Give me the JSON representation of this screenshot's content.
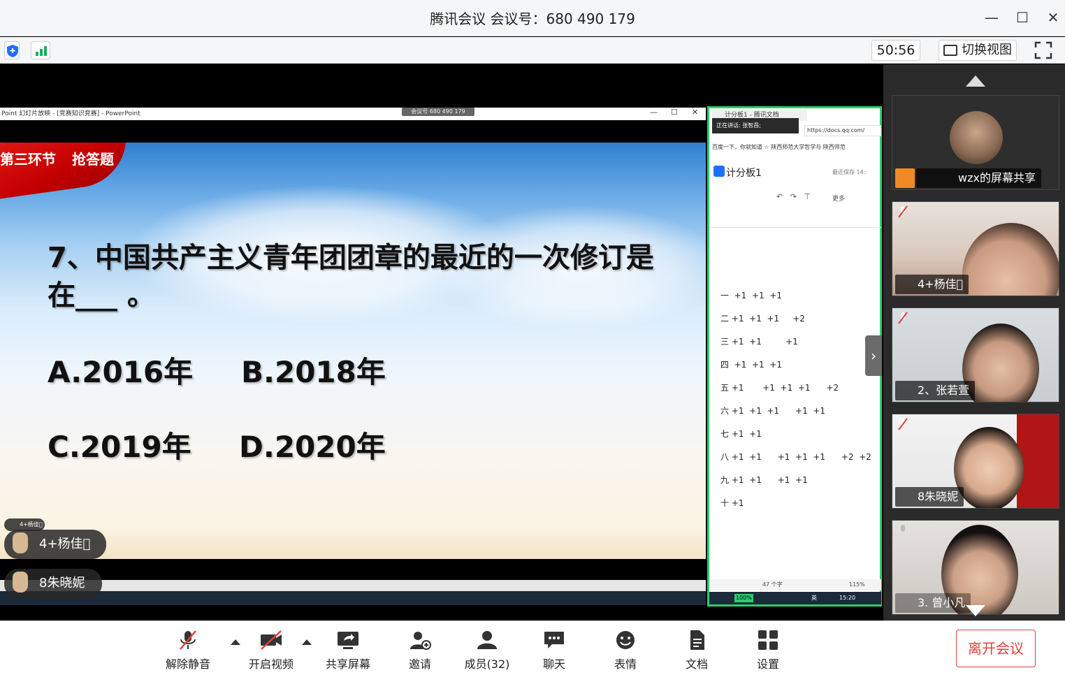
{
  "window": {
    "title": "腾讯会议 会议号：680 490 179",
    "minimize": "—",
    "maximize": "☐",
    "close": "✕"
  },
  "infobar": {
    "timer": "50:56",
    "switch_view": "切换视图"
  },
  "ppt": {
    "window_title": "Point 幻灯片放映 - [竞赛知识竞赛] - PowerPoint",
    "meeting_tag": "会议号 680 490 179",
    "section_label": "第三环节",
    "section_name": "抢答题",
    "question": "7、中国共产主义青年团团章的最近的一次修订是在___ 。",
    "option_a": "A.2016年",
    "option_b": "B.2018年",
    "option_c": "C.2019年",
    "option_d": "D.2020年"
  },
  "raised_hands": [
    {
      "name": "4+杨佳\u0000",
      "mini": "4+杨佳\u0000"
    },
    {
      "name": "8朱晓妮"
    }
  ],
  "doc": {
    "tab_title": "计分板1 - 腾讯文档",
    "speaking": "正在讲话: 张智昌;",
    "url": "https://docs.qq.com/",
    "bookmarks": "百度一下，你就知道  ☆ 陕西师范大学哲学与  陕西师范",
    "title": "计分板1",
    "saved": "最近保存 14:",
    "more": "更多",
    "word_count": "47 个字",
    "zoom": "115%",
    "lang": "英",
    "clock": "15:20",
    "battery": "100%",
    "scores": [
      "一  +1  +1  +1",
      "二 +1  +1  +1     +2",
      "三 +1  +1         +1",
      "四  +1  +1  +1",
      "五 +1       +1  +1  +1      +2",
      "六 +1  +1  +1      +1  +1",
      "七 +1  +1",
      "八 +1  +1      +1  +1  +1      +2  +2",
      "九 +1  +1      +1  +1",
      "十 +1"
    ]
  },
  "gallery": {
    "tiles": [
      {
        "name": "wzx的屏幕共享"
      },
      {
        "name": "4+杨佳\u0000"
      },
      {
        "name": "2、张若萱"
      },
      {
        "name": "8朱晓妮"
      },
      {
        "name": "3. 曾小凡"
      }
    ]
  },
  "toolbar": {
    "unmute": "解除静音",
    "start_video": "开启视频",
    "share_screen": "共享屏幕",
    "invite": "邀请",
    "members": "成员(32)",
    "chat": "聊天",
    "reactions": "表情",
    "docs": "文档",
    "settings": "设置",
    "leave": "离开会议"
  },
  "colors": {
    "accent_green": "#2bcf6a",
    "leave_red": "#e0413a",
    "slide_flag": "#d60000"
  }
}
